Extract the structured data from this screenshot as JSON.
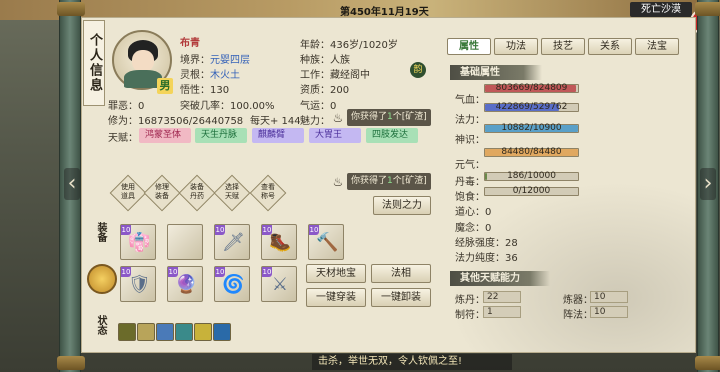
{
  "topbar": {
    "date": "第450年11月19天",
    "location": "死亡沙漠",
    "close": "✕"
  },
  "side_title": "个人信息",
  "character": {
    "name": "布青",
    "gender": "男",
    "realm_label": "境界：",
    "realm": "元婴四层",
    "root_label": "灵根：",
    "root": "木火土",
    "insight_label": "悟性：",
    "insight": "130",
    "sin_label": "罪恶：",
    "sin": "0",
    "break_label": "突破几率：",
    "break_rate": "100.00%",
    "cult_label": "修为：",
    "cultivation": "16873506/26440758",
    "daily": "每天+ 144",
    "age_label": "年龄：",
    "age": "436岁/1020岁",
    "race_label": "种族：",
    "race": "人族",
    "job_label": "工作：",
    "job": "藏经阁中",
    "aptitude_label": "资质：",
    "aptitude": "200",
    "luck_label": "气运：",
    "luck": "0",
    "charm_label": "魅力：",
    "badge": "韵"
  },
  "talents": {
    "label": "天赋：",
    "items": [
      "鸿蒙圣体",
      "天生丹脉",
      "麒麟臂",
      "大胃王",
      "四肢发达"
    ]
  },
  "messages": [
    {
      "prefix": "你获得了",
      "count": "1",
      "suffix": "个[矿渣]"
    },
    {
      "prefix": "你获得了",
      "count": "1",
      "suffix": "个[矿渣]"
    }
  ],
  "skills": [
    {
      "line1": "使用",
      "line2": "道具"
    },
    {
      "line1": "修理",
      "line2": "装备"
    },
    {
      "line1": "装备",
      "line2": "丹药"
    },
    {
      "line1": "选择",
      "line2": "天赋"
    },
    {
      "line1": "查看",
      "line2": "称号"
    }
  ],
  "law_button": "法则之力",
  "sections": {
    "equip": "装备",
    "bag_label": "",
    "status": "状态"
  },
  "equip_buttons": {
    "treasure": "天材地宝",
    "fa_xiang": "法相",
    "wear_all": "一键穿装",
    "remove_all": "一键卸装"
  },
  "equip_slots": [
    {
      "tag": "10",
      "icon": "robe-icon",
      "glyph": "👘",
      "color": "#8c6ad6"
    },
    {
      "tag": "",
      "icon": "empty-slot",
      "glyph": "",
      "color": ""
    },
    {
      "tag": "10",
      "icon": "sword-icon",
      "glyph": "🗡",
      "color": "#5a6e8a"
    },
    {
      "tag": "10",
      "icon": "boots-icon",
      "glyph": "🥾",
      "color": "#8c6ad6"
    },
    {
      "tag": "10",
      "icon": "hammer-icon",
      "glyph": "🔨",
      "color": "#b83a3a"
    },
    {
      "tag": "10",
      "icon": "armor-icon",
      "glyph": "🛡",
      "color": "#5a6e8a"
    },
    {
      "tag": "10",
      "icon": "orb-icon",
      "glyph": "🔮",
      "color": "#8c6ad6"
    },
    {
      "tag": "10",
      "icon": "vortex-icon",
      "glyph": "🌀",
      "color": "#8c6ad6"
    },
    {
      "tag": "10",
      "icon": "dagger-icon",
      "glyph": "⚔",
      "color": "#5a6e8a"
    }
  ],
  "status_colors": [
    "#6b6b2a",
    "#b8a45a",
    "#4a7ab8",
    "#3a8a8a",
    "#c8b23a",
    "#2a6aa8"
  ],
  "tabs": [
    "属性",
    "功法",
    "技艺",
    "关系",
    "法宝"
  ],
  "attributes": {
    "header": "基础属性",
    "qixue_label": "气血：",
    "qixue": "803669/824809",
    "qixue_ratio": 0.974,
    "fali_label": "法力：",
    "fali": "422869/529762",
    "fali_ratio": 0.798,
    "shenshi_label": "神识：",
    "shenshi": "10882/10900",
    "shenshi_ratio": 0.998,
    "yuanqi_label": "元气：",
    "yuanqi": "84480/84480",
    "yuanqi_ratio": 1.0,
    "dandu_label": "丹毒：",
    "dandu": "186/10000",
    "dandu_ratio": 0.0186,
    "baoshi_label": "饱食：",
    "baoshi": "0/12000",
    "baoshi_ratio": 0.0,
    "daoxin_label": "道心：",
    "daoxin": "0",
    "monian_label": "魔念：",
    "monian": "0",
    "jingmai_label": "经脉强度：",
    "jingmai": "28",
    "chundu_label": "法力纯度：",
    "chundu": "36"
  },
  "other": {
    "header": "其他天赋能力",
    "liandan_label": "炼丹：",
    "liandan": "22",
    "lianqi_label": "炼器：",
    "lianqi": "10",
    "zhifu_label": "制符：",
    "zhifu": "1",
    "zhenfa_label": "阵法：",
    "zhenfa": "10"
  },
  "ticker": "击杀，举世无双，令人钦佩之至!"
}
